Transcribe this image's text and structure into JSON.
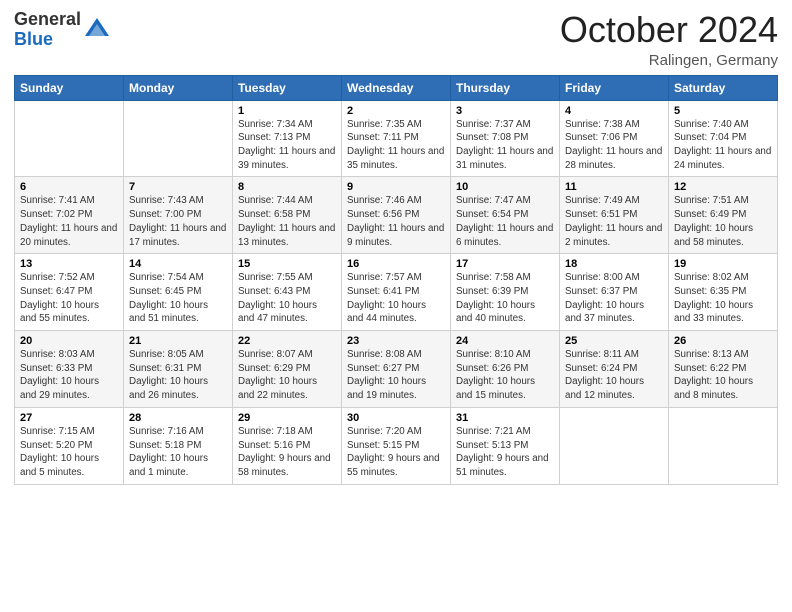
{
  "header": {
    "logo_general": "General",
    "logo_blue": "Blue",
    "month_year": "October 2024",
    "location": "Ralingen, Germany"
  },
  "days_of_week": [
    "Sunday",
    "Monday",
    "Tuesday",
    "Wednesday",
    "Thursday",
    "Friday",
    "Saturday"
  ],
  "weeks": [
    [
      {
        "day": "",
        "info": ""
      },
      {
        "day": "",
        "info": ""
      },
      {
        "day": "1",
        "info": "Sunrise: 7:34 AM\nSunset: 7:13 PM\nDaylight: 11 hours and 39 minutes."
      },
      {
        "day": "2",
        "info": "Sunrise: 7:35 AM\nSunset: 7:11 PM\nDaylight: 11 hours and 35 minutes."
      },
      {
        "day": "3",
        "info": "Sunrise: 7:37 AM\nSunset: 7:08 PM\nDaylight: 11 hours and 31 minutes."
      },
      {
        "day": "4",
        "info": "Sunrise: 7:38 AM\nSunset: 7:06 PM\nDaylight: 11 hours and 28 minutes."
      },
      {
        "day": "5",
        "info": "Sunrise: 7:40 AM\nSunset: 7:04 PM\nDaylight: 11 hours and 24 minutes."
      }
    ],
    [
      {
        "day": "6",
        "info": "Sunrise: 7:41 AM\nSunset: 7:02 PM\nDaylight: 11 hours and 20 minutes."
      },
      {
        "day": "7",
        "info": "Sunrise: 7:43 AM\nSunset: 7:00 PM\nDaylight: 11 hours and 17 minutes."
      },
      {
        "day": "8",
        "info": "Sunrise: 7:44 AM\nSunset: 6:58 PM\nDaylight: 11 hours and 13 minutes."
      },
      {
        "day": "9",
        "info": "Sunrise: 7:46 AM\nSunset: 6:56 PM\nDaylight: 11 hours and 9 minutes."
      },
      {
        "day": "10",
        "info": "Sunrise: 7:47 AM\nSunset: 6:54 PM\nDaylight: 11 hours and 6 minutes."
      },
      {
        "day": "11",
        "info": "Sunrise: 7:49 AM\nSunset: 6:51 PM\nDaylight: 11 hours and 2 minutes."
      },
      {
        "day": "12",
        "info": "Sunrise: 7:51 AM\nSunset: 6:49 PM\nDaylight: 10 hours and 58 minutes."
      }
    ],
    [
      {
        "day": "13",
        "info": "Sunrise: 7:52 AM\nSunset: 6:47 PM\nDaylight: 10 hours and 55 minutes."
      },
      {
        "day": "14",
        "info": "Sunrise: 7:54 AM\nSunset: 6:45 PM\nDaylight: 10 hours and 51 minutes."
      },
      {
        "day": "15",
        "info": "Sunrise: 7:55 AM\nSunset: 6:43 PM\nDaylight: 10 hours and 47 minutes."
      },
      {
        "day": "16",
        "info": "Sunrise: 7:57 AM\nSunset: 6:41 PM\nDaylight: 10 hours and 44 minutes."
      },
      {
        "day": "17",
        "info": "Sunrise: 7:58 AM\nSunset: 6:39 PM\nDaylight: 10 hours and 40 minutes."
      },
      {
        "day": "18",
        "info": "Sunrise: 8:00 AM\nSunset: 6:37 PM\nDaylight: 10 hours and 37 minutes."
      },
      {
        "day": "19",
        "info": "Sunrise: 8:02 AM\nSunset: 6:35 PM\nDaylight: 10 hours and 33 minutes."
      }
    ],
    [
      {
        "day": "20",
        "info": "Sunrise: 8:03 AM\nSunset: 6:33 PM\nDaylight: 10 hours and 29 minutes."
      },
      {
        "day": "21",
        "info": "Sunrise: 8:05 AM\nSunset: 6:31 PM\nDaylight: 10 hours and 26 minutes."
      },
      {
        "day": "22",
        "info": "Sunrise: 8:07 AM\nSunset: 6:29 PM\nDaylight: 10 hours and 22 minutes."
      },
      {
        "day": "23",
        "info": "Sunrise: 8:08 AM\nSunset: 6:27 PM\nDaylight: 10 hours and 19 minutes."
      },
      {
        "day": "24",
        "info": "Sunrise: 8:10 AM\nSunset: 6:26 PM\nDaylight: 10 hours and 15 minutes."
      },
      {
        "day": "25",
        "info": "Sunrise: 8:11 AM\nSunset: 6:24 PM\nDaylight: 10 hours and 12 minutes."
      },
      {
        "day": "26",
        "info": "Sunrise: 8:13 AM\nSunset: 6:22 PM\nDaylight: 10 hours and 8 minutes."
      }
    ],
    [
      {
        "day": "27",
        "info": "Sunrise: 7:15 AM\nSunset: 5:20 PM\nDaylight: 10 hours and 5 minutes."
      },
      {
        "day": "28",
        "info": "Sunrise: 7:16 AM\nSunset: 5:18 PM\nDaylight: 10 hours and 1 minute."
      },
      {
        "day": "29",
        "info": "Sunrise: 7:18 AM\nSunset: 5:16 PM\nDaylight: 9 hours and 58 minutes."
      },
      {
        "day": "30",
        "info": "Sunrise: 7:20 AM\nSunset: 5:15 PM\nDaylight: 9 hours and 55 minutes."
      },
      {
        "day": "31",
        "info": "Sunrise: 7:21 AM\nSunset: 5:13 PM\nDaylight: 9 hours and 51 minutes."
      },
      {
        "day": "",
        "info": ""
      },
      {
        "day": "",
        "info": ""
      }
    ]
  ]
}
